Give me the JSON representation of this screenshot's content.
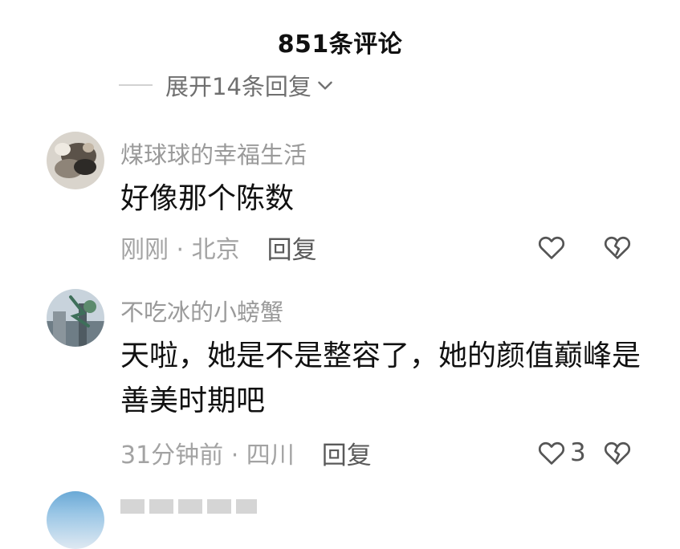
{
  "header": {
    "title": "851条评论"
  },
  "expand_replies": {
    "label": "展开14条回复"
  },
  "comments": [
    {
      "author": "煤球球的幸福生活",
      "text": "好像那个陈数",
      "time_location": "刚刚 · 北京",
      "reply_label": "回复",
      "like_count": ""
    },
    {
      "author": "不吃冰的小螃蟹",
      "text": "天啦，她是不是整容了，她的颜值巅峰是善美时期吧",
      "time_location": "31分钟前 · 四川",
      "reply_label": "回复",
      "like_count": "3"
    }
  ],
  "colors": {
    "author": "#9a9a9a",
    "meta": "#a3a3a3",
    "text": "#111111",
    "icon_stroke": "#555555"
  },
  "icons": {
    "like": "heart-outline-icon",
    "dislike": "broken-heart-icon",
    "expand": "chevron-down-icon"
  }
}
